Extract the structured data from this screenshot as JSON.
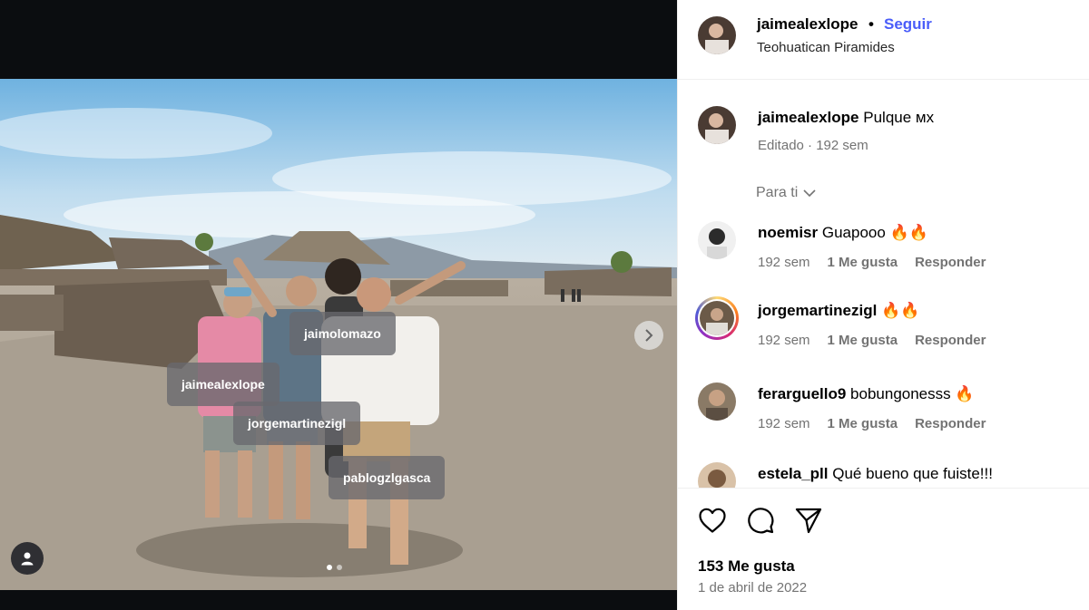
{
  "post": {
    "username": "jaimealexlope",
    "separator": "•",
    "follow_label": "Seguir",
    "location": "Teohuatican Piramides"
  },
  "caption": {
    "username": "jaimealexlope",
    "text": "Pulque ᴍx",
    "meta": "Editado · 192 sem"
  },
  "sort_label": "Para ti",
  "comments": [
    {
      "username": "noemisr",
      "text": "Guapooo 🔥🔥",
      "age": "192 sem",
      "likes": "1 Me gusta",
      "reply": "Responder"
    },
    {
      "username": "jorgemartinezigl",
      "text": "🔥🔥",
      "age": "192 sem",
      "likes": "1 Me gusta",
      "reply": "Responder"
    },
    {
      "username": "ferarguello9",
      "text": "bobungonesss 🔥",
      "age": "192 sem",
      "likes": "1 Me gusta",
      "reply": "Responder"
    },
    {
      "username": "estela_pll",
      "text": "Qué bueno que fuiste!!!",
      "age": "",
      "likes": "",
      "reply": ""
    }
  ],
  "photo_tags": [
    "jaimolomazo",
    "jaimealexlope",
    "jorgemartinezigl",
    "pablogzlgasca"
  ],
  "likes_count": "153 Me gusta",
  "post_date": "1 de abril de 2022",
  "carousel": {
    "current": 1,
    "total": 2
  },
  "icons": {
    "like": "heart-icon",
    "comment": "comment-bubble-icon",
    "share": "paper-plane-icon",
    "next": "chevron-right-icon",
    "tagged_users": "user-icon"
  },
  "colors": {
    "follow": "#4a5df9",
    "muted": "#737373",
    "border": "#efefef"
  }
}
